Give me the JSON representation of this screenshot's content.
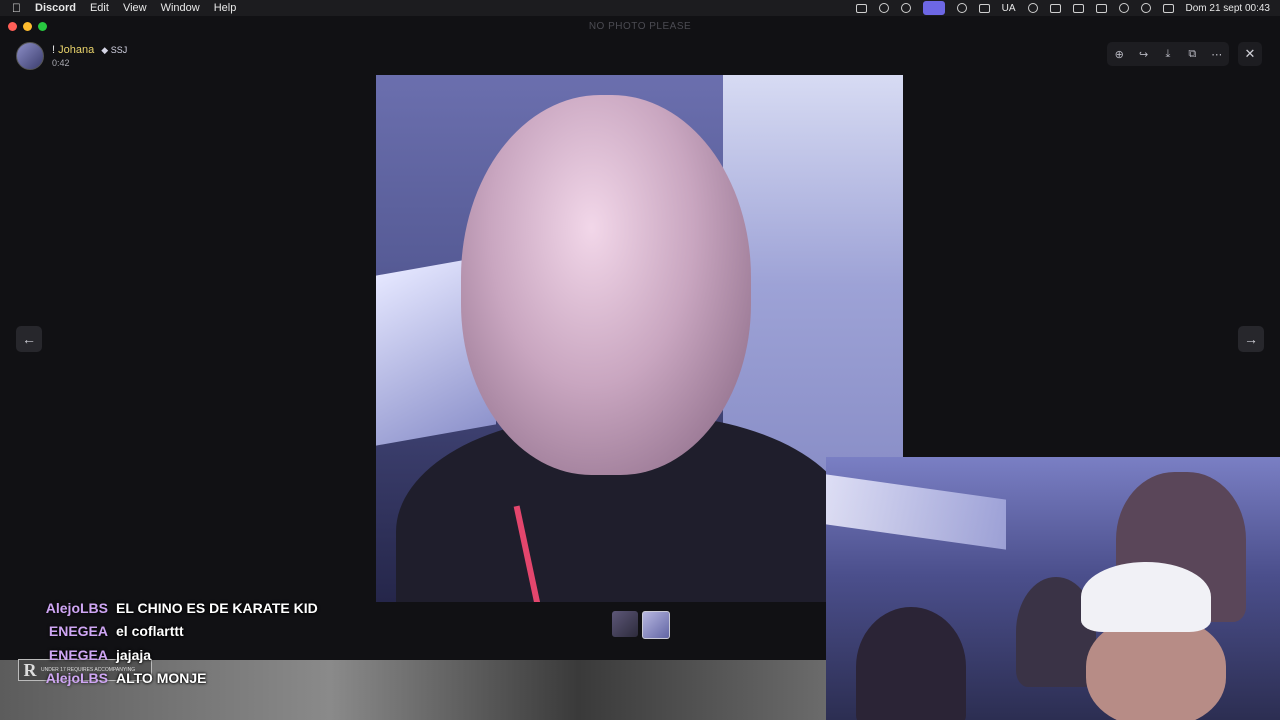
{
  "menubar": {
    "apple": "",
    "app": "Discord",
    "menus": [
      "Edit",
      "View",
      "Window",
      "Help"
    ],
    "input_source": "UA",
    "datetime": "Dom 21 sept  00:43"
  },
  "window": {
    "title": "NO PHOTO PLEASE"
  },
  "viewer": {
    "user_prefix": "! ",
    "user_name": "Johana",
    "badge": "SSJ",
    "time": "0:42"
  },
  "toolbar": {
    "zoom": "⊕",
    "forward": "↪",
    "download": "⤓",
    "open": "⧉",
    "more": "⋯",
    "close": "✕"
  },
  "nav": {
    "prev": "←",
    "next": "→"
  },
  "chat": [
    {
      "user": "AlejoLBS",
      "message": "EL CHINO ES DE KARATE KID"
    },
    {
      "user": "ENEGEA",
      "message": "el coflarttt"
    },
    {
      "user": "ENEGEA",
      "message": "jajaja"
    },
    {
      "user": "AlejoLBS",
      "message": "ALTO MONJE"
    }
  ],
  "rating": {
    "letter": "R",
    "text": "UNDER 17 REQUIRES ACCOMPANYING"
  },
  "colors": {
    "chat_user": "#cfa6f4",
    "active_tray": "#6d67e4",
    "username": "#e9d36b"
  }
}
